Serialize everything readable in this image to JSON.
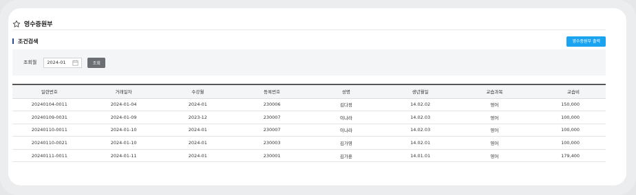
{
  "page": {
    "title": "영수증원부"
  },
  "section": {
    "title": "조건검색",
    "export_label": "영수증원부 출력"
  },
  "search": {
    "label": "조회월",
    "month_value": "2024-01",
    "button_label": "조회"
  },
  "table": {
    "columns": [
      "일련번호",
      "거래일자",
      "수강월",
      "등록번호",
      "성명",
      "생년월일",
      "교습과목",
      "교습비"
    ],
    "rows": [
      [
        "20240104-0011",
        "2024-01-04",
        "2024-01",
        "230006",
        "김다정",
        "14.02.02",
        "영어",
        "150,000"
      ],
      [
        "20240109-0031",
        "2024-01-09",
        "2023-12",
        "230007",
        "이나라",
        "14.02.03",
        "영어",
        "100,000"
      ],
      [
        "20240110-0011",
        "2024-01-10",
        "2024-01",
        "230007",
        "이나라",
        "14.02.03",
        "영어",
        "100,000"
      ],
      [
        "20240110-0021",
        "2024-01-10",
        "2024-01",
        "230003",
        "김가영",
        "14.02.01",
        "영어",
        "100,000"
      ],
      [
        "20240111-0011",
        "2024-01-11",
        "2024-01",
        "230001",
        "김가훈",
        "14.01.01",
        "영어",
        "179,400"
      ]
    ]
  },
  "icons": {
    "title_icon": "star-outline-icon",
    "date_icon": "calendar-icon"
  },
  "colors": {
    "accent": "#1aa3f0",
    "section_bar": "#2a4b8d",
    "search_button": "#6b6e73"
  }
}
